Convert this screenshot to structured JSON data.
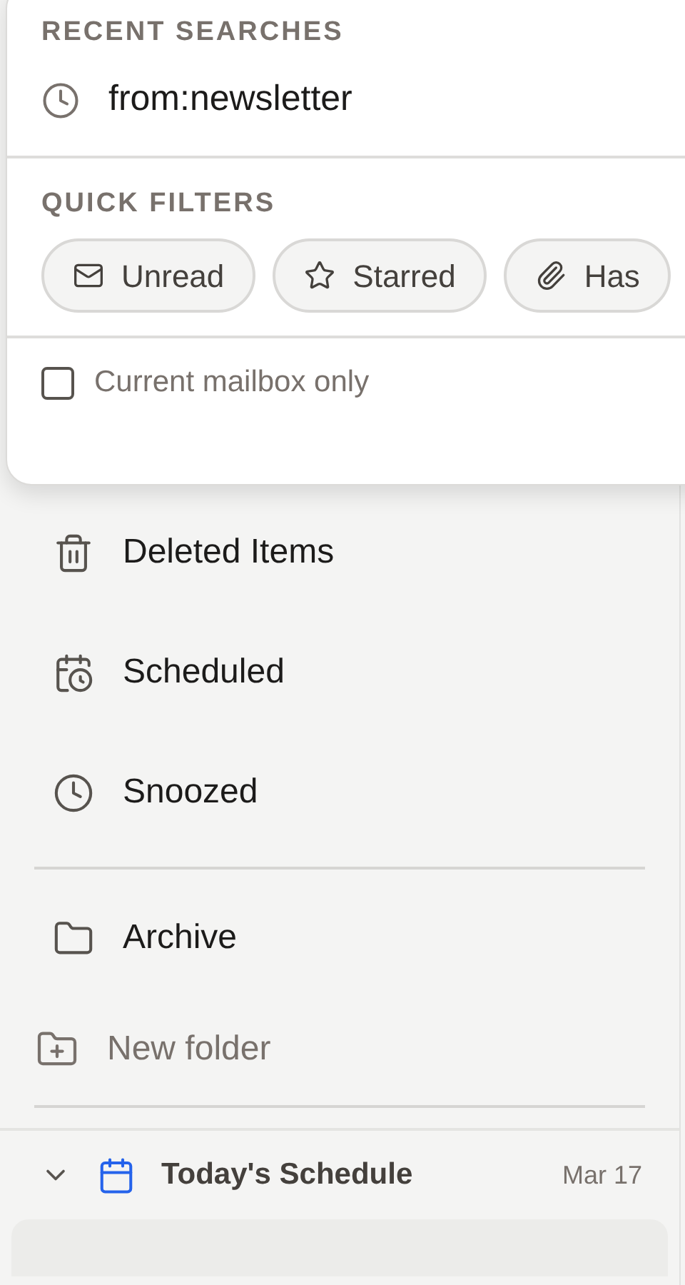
{
  "search_popup": {
    "recent_heading": "RECENT SEARCHES",
    "recent": [
      {
        "text": "from:newsletter"
      }
    ],
    "filters_heading": "QUICK FILTERS",
    "filters": [
      {
        "kind": "unread",
        "label": "Unread"
      },
      {
        "kind": "starred",
        "label": "Starred"
      },
      {
        "kind": "attachment",
        "label": "Has"
      }
    ],
    "scope": {
      "label": "Current mailbox only",
      "checked": false
    }
  },
  "folders": [
    {
      "kind": "trash",
      "label": "Deleted Items"
    },
    {
      "kind": "scheduled",
      "label": "Scheduled"
    },
    {
      "kind": "snoozed",
      "label": "Snoozed"
    }
  ],
  "custom_folders": [
    {
      "kind": "folder",
      "label": "Archive"
    }
  ],
  "new_folder": "New folder",
  "schedule": {
    "title": "Today's Schedule",
    "date": "Mar 17",
    "expanded": true
  }
}
